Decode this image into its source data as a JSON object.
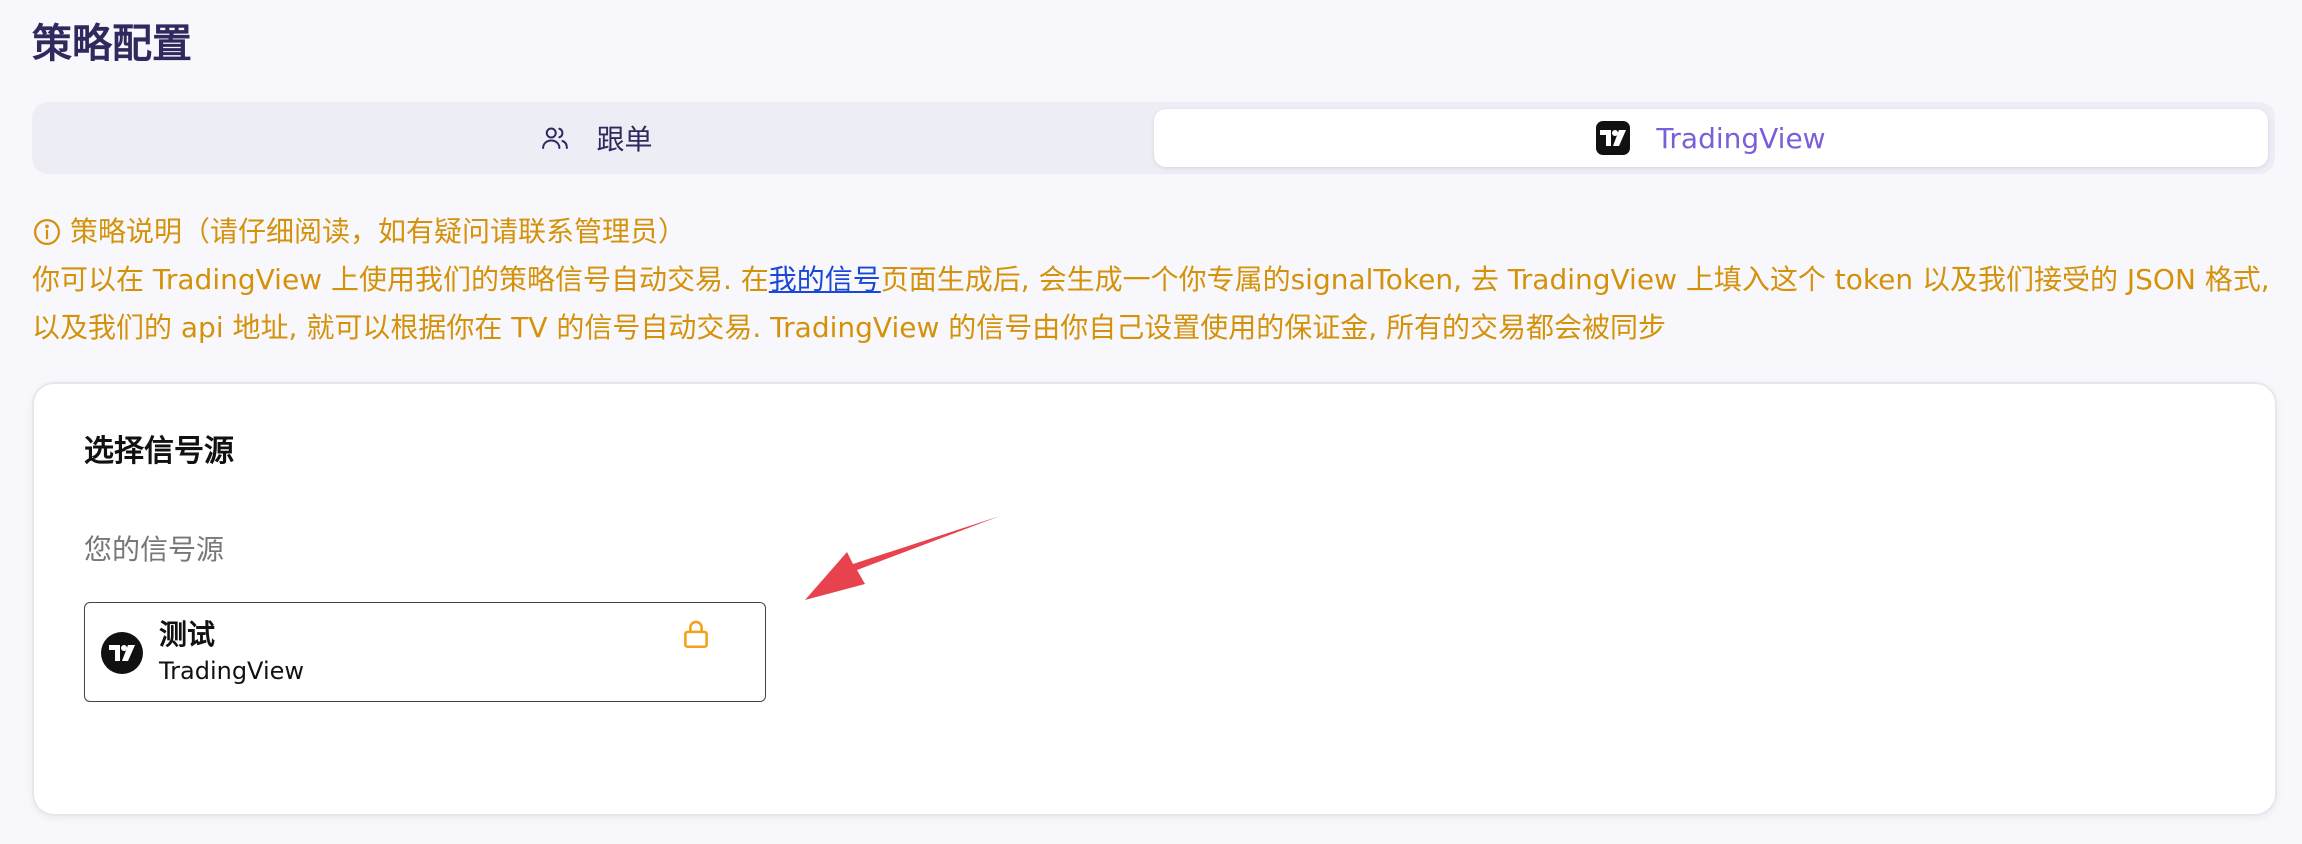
{
  "page": {
    "title": "策略配置"
  },
  "tabs": [
    {
      "label": "跟单",
      "icon": "users-icon",
      "active": false
    },
    {
      "label": "TradingView",
      "icon": "tradingview-logo-icon",
      "active": true
    }
  ],
  "notice": {
    "heading": "策略说明（请仔细阅读，如有疑问请联系管理员）",
    "text_before_link": "你可以在 TradingView 上使用我们的策略信号自动交易. 在",
    "link_label": "我的信号",
    "text_after_link": "页面生成后, 会生成一个你专属的signalToken, 去 TradingView 上填入这个 token 以及我们接受的 JSON 格式, 以及我们的 api 地址, 就可以根据你在 TV 的信号自动交易. TradingView 的信号由你自己设置使用的保证金, 所有的交易都会被同步",
    "color": "#d4920b"
  },
  "signal_source": {
    "title": "选择信号源",
    "subtitle": "您的信号源",
    "items": [
      {
        "name": "测试",
        "type": "TradingView",
        "icon": "tradingview-logo-icon",
        "status_icon": "lock-icon"
      }
    ]
  },
  "colors": {
    "accent": "#7c5fd8",
    "title": "#2f2a5e",
    "warning": "#d4920b",
    "annotation_arrow": "#e8424f"
  }
}
